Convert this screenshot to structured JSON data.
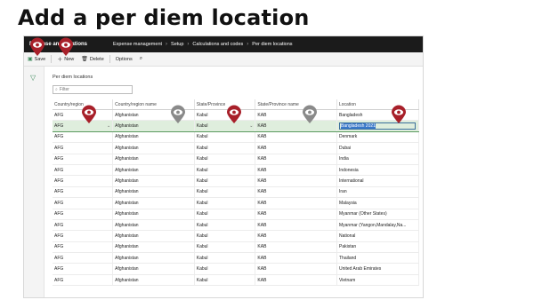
{
  "slide": {
    "title": "Add a per diem location"
  },
  "navbar": {
    "app_name": "Expense and locations",
    "breadcrumbs": [
      "Expense management",
      "Setup",
      "Calculations and codes",
      "Per diem locations"
    ]
  },
  "toolbar": {
    "save_label": "Save",
    "new_label": "New",
    "delete_label": "Delete",
    "options_label": "Options"
  },
  "page": {
    "section_label": "Per diem locations",
    "filter_placeholder": "Filter"
  },
  "grid": {
    "columns": [
      "Country/region",
      "Country/region name",
      "State/Province",
      "State/Province name",
      "Location"
    ],
    "rows": [
      [
        "AFG",
        "Afghanistan",
        "Kabul",
        "KAB",
        "Bangladesh"
      ],
      [
        "AFG",
        "Afghanistan",
        "Kabul",
        "KAB",
        "Bangladesh 2021"
      ],
      [
        "AFG",
        "Afghanistan",
        "Kabul",
        "KAB",
        "Denmark"
      ],
      [
        "AFG",
        "Afghanistan",
        "Kabul",
        "KAB",
        "Dubai"
      ],
      [
        "AFG",
        "Afghanistan",
        "Kabul",
        "KAB",
        "India"
      ],
      [
        "AFG",
        "Afghanistan",
        "Kabul",
        "KAB",
        "Indonesia"
      ],
      [
        "AFG",
        "Afghanistan",
        "Kabul",
        "KAB",
        "International"
      ],
      [
        "AFG",
        "Afghanistan",
        "Kabul",
        "KAB",
        "Iran"
      ],
      [
        "AFG",
        "Afghanistan",
        "Kabul",
        "KAB",
        "Malaysia"
      ],
      [
        "AFG",
        "Afghanistan",
        "Kabul",
        "KAB",
        "Myanmar (Other States)"
      ],
      [
        "AFG",
        "Afghanistan",
        "Kabul",
        "KAB",
        "Myanmar (Yangon,Mandalay,Na..."
      ],
      [
        "AFG",
        "Afghanistan",
        "Kabul",
        "KAB",
        "National"
      ],
      [
        "AFG",
        "Afghanistan",
        "Kabul",
        "KAB",
        "Pakistan"
      ],
      [
        "AFG",
        "Afghanistan",
        "Kabul",
        "KAB",
        "Thailand"
      ],
      [
        "AFG",
        "Afghanistan",
        "Kabul",
        "KAB",
        "United Arab Emirates"
      ],
      [
        "AFG",
        "Afghanistan",
        "Kabul",
        "KAB",
        "Vietnam"
      ]
    ]
  },
  "markers": {
    "active_color": "#a8202a",
    "inactive_color": "#8a8a8a",
    "icon": "eye-pin-icon"
  }
}
